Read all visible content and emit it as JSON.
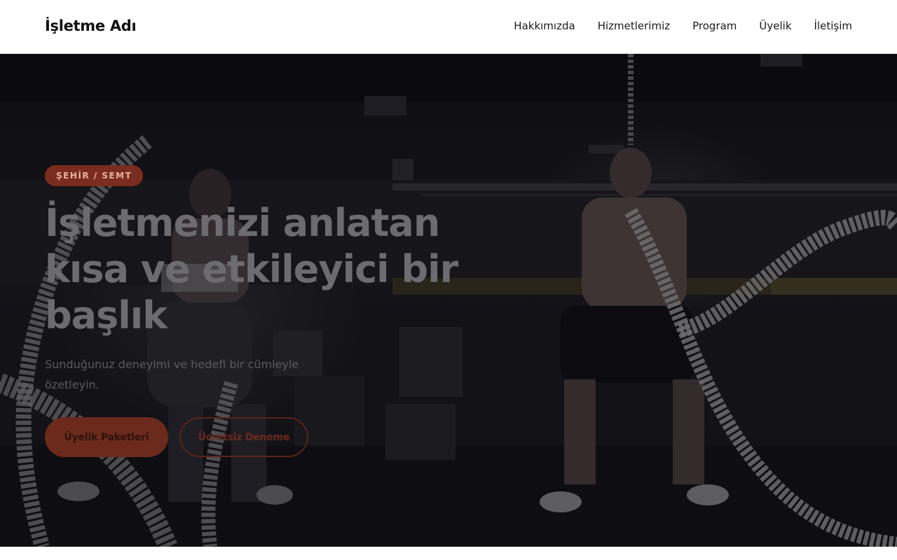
{
  "header": {
    "brand": "İşletme Adı",
    "nav": [
      {
        "label": "Hakkımızda"
      },
      {
        "label": "Hizmetlerimiz"
      },
      {
        "label": "Program"
      },
      {
        "label": "Üyelik"
      },
      {
        "label": "İletişim"
      }
    ]
  },
  "hero": {
    "badge": "ŞEHİR / SEMT",
    "title_lines": [
      "İşletmenizi anlatan",
      "kısa ve etkileyici bir",
      "başlık"
    ],
    "subtitle": "Sunduğunuz deneyimi ve hedefi bir cümleyle özetleyin.",
    "primary_button": "Üyelik Paketleri",
    "secondary_button": "Ücretsiz Deneme"
  },
  "colors": {
    "accent": "#7a2d1e",
    "hero_background": "#16151a"
  }
}
